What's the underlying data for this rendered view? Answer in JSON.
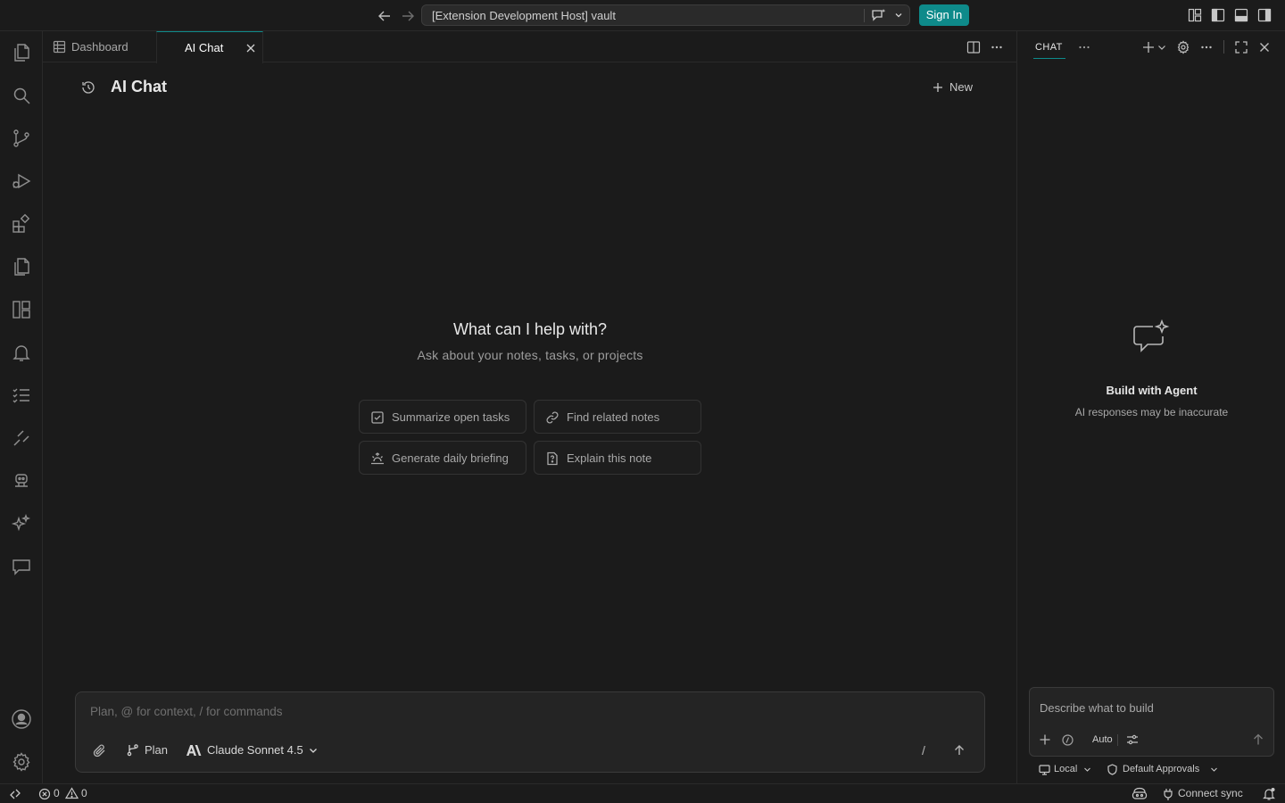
{
  "titlebar": {
    "command_center_text": "[Extension Development Host] vault",
    "sign_in_label": "Sign In",
    "accent_color": "#0e8a8a"
  },
  "activity_bar": {
    "top_icons": [
      "explorer-icon",
      "search-icon",
      "source-control-icon",
      "run-debug-icon",
      "extensions-icon",
      "pages-icon",
      "dashboard-layout-icon",
      "notifications-icon",
      "tasks-icon",
      "remote-tools-icon",
      "agent-robot-icon",
      "sparkles-icon",
      "chat-bubble-icon"
    ],
    "bottom_icons": [
      "account-icon",
      "settings-gear-icon"
    ]
  },
  "editor": {
    "tabs": [
      {
        "label": "Dashboard",
        "icon": "table-icon",
        "active": false
      },
      {
        "label": "AI Chat",
        "active": true
      }
    ],
    "page_title": "AI Chat",
    "new_label": "New",
    "hero_title": "What can I help with?",
    "hero_subtitle": "Ask about your notes, tasks, or projects",
    "suggestions": [
      {
        "label": "Summarize open tasks",
        "icon": "checkbox-icon"
      },
      {
        "label": "Find related notes",
        "icon": "link-icon"
      },
      {
        "label": "Generate daily briefing",
        "icon": "sunrise-icon"
      },
      {
        "label": "Explain this note",
        "icon": "question-file-icon"
      }
    ],
    "composer": {
      "placeholder": "Plan, @ for context, / for commands",
      "mode_label": "Plan",
      "model_label": "Claude Sonnet 4.5",
      "slash_label": "/"
    }
  },
  "chat_panel": {
    "header_title": "CHAT",
    "empty_title": "Build with Agent",
    "empty_subtitle": "AI responses may be inaccurate",
    "input_placeholder": "Describe what to build",
    "auto_label": "Auto",
    "local_label": "Local",
    "approvals_label": "Default Approvals"
  },
  "statusbar": {
    "errors": "0",
    "warnings": "0",
    "sync_label": "Connect sync"
  }
}
